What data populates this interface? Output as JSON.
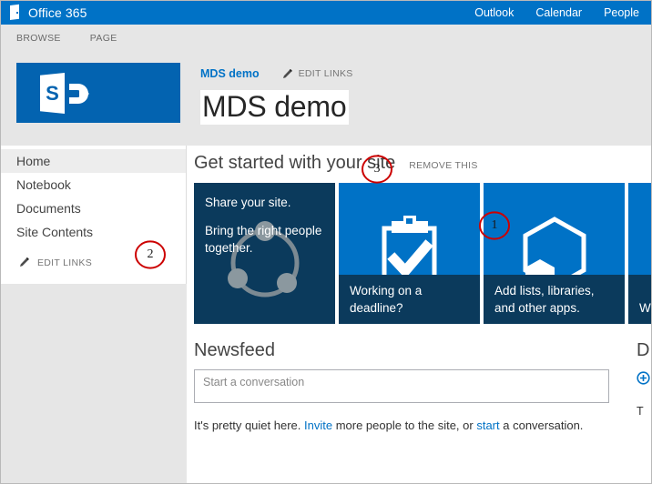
{
  "suite_bar": {
    "brand": "Office 365",
    "brand_icon": "office-waffle-icon",
    "links": [
      {
        "label": "Outlook"
      },
      {
        "label": "Calendar"
      },
      {
        "label": "People"
      }
    ]
  },
  "ribbon": {
    "tabs": [
      {
        "label": "BROWSE"
      },
      {
        "label": "PAGE"
      }
    ]
  },
  "site_header": {
    "logo_icon": "sharepoint-logo-icon",
    "breadcrumb": "MDS demo",
    "edit_links": {
      "label": "EDIT LINKS",
      "icon": "pencil-icon"
    },
    "title": "MDS demo"
  },
  "left_nav": {
    "items": [
      {
        "label": "Home",
        "selected": true
      },
      {
        "label": "Notebook",
        "selected": false
      },
      {
        "label": "Documents",
        "selected": false
      },
      {
        "label": "Site Contents",
        "selected": false
      }
    ],
    "edit_links": {
      "label": "EDIT LINKS",
      "icon": "pencil-icon"
    }
  },
  "get_started": {
    "title": "Get started with your site",
    "remove_label": "REMOVE THIS",
    "tiles": [
      {
        "id": "share-your-site",
        "style": "dark",
        "line1": "Share your site.",
        "line2": "Bring the right people together.",
        "icon": "share-people-icon"
      },
      {
        "id": "working-on-a-deadline",
        "style": "blue-band",
        "caption": "Working on a deadline?",
        "icon": "clipboard-check-icon"
      },
      {
        "id": "add-lists-libraries",
        "style": "blue-band",
        "caption": "Add lists, libraries, and other apps.",
        "icon": "hexagon-apps-icon"
      },
      {
        "id": "whats-your-style",
        "style": "blue-band",
        "caption": "W",
        "icon": "paint-icon"
      }
    ]
  },
  "newsfeed": {
    "title": "Newsfeed",
    "conversation_placeholder": "Start a conversation",
    "conversation_value": "",
    "empty_prefix": "It's pretty quiet here. ",
    "empty_link_1": "Invite",
    "empty_middle": " more people to the site, or ",
    "empty_link_2": "start",
    "empty_suffix": " a conversation."
  },
  "documents": {
    "title": "D",
    "add_icon": "plus-circle-icon",
    "sub": "T"
  },
  "annotations": [
    {
      "number": "1",
      "target": "get-started-remove-this"
    },
    {
      "number": "2",
      "target": "left-nav"
    },
    {
      "number": "3",
      "target": "site-title"
    }
  ],
  "colors": {
    "suite_blue": "#0072c6",
    "tile_blue": "#0072c6",
    "tile_dark": "#0b3a5c",
    "link_blue": "#0072c6",
    "annotation_red": "#cc0000",
    "page_bg": "#e6e6e6"
  }
}
